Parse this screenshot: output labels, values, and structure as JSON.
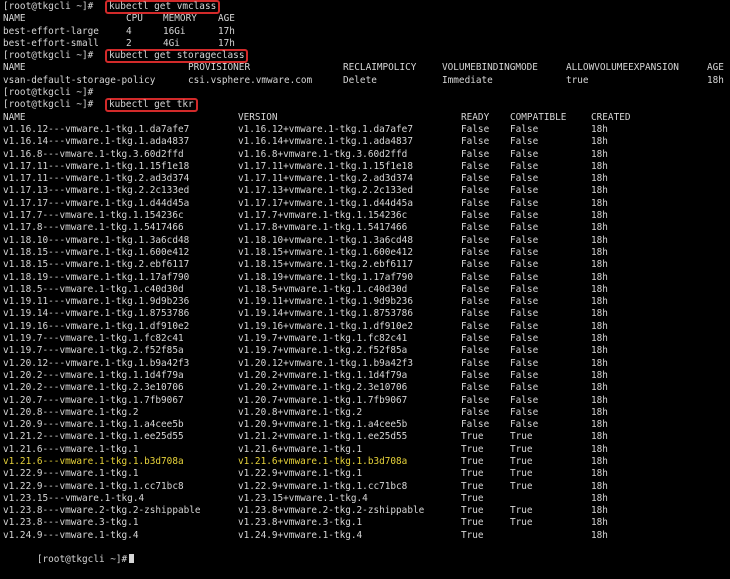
{
  "prompt": "[root@tkgcli ~]#",
  "blocks": [
    {
      "command": "kubectl get vmclass",
      "headers": [
        "NAME",
        "CPU",
        "MEMORY",
        "AGE"
      ],
      "rows": [
        [
          "best-effort-large",
          "4",
          "16Gi",
          "17h"
        ],
        [
          "best-effort-small",
          "2",
          "4Gi",
          "17h"
        ]
      ]
    },
    {
      "command": "kubectl get storageclass",
      "headers": [
        "NAME",
        "PROVISIONER",
        "RECLAIMPOLICY",
        "VOLUMEBINDINGMODE",
        "ALLOWVOLUMEEXPANSION",
        "AGE"
      ],
      "rows": [
        [
          "vsan-default-storage-policy",
          "csi.vsphere.vmware.com",
          "Delete",
          "Immediate",
          "true",
          "18h"
        ]
      ]
    },
    {
      "command": "kubectl get tkr",
      "headers": [
        "NAME",
        "VERSION",
        "READY",
        "COMPATIBLE",
        "CREATED"
      ],
      "rows": [
        [
          "v1.16.12---vmware.1-tkg.1.da7afe7",
          "v1.16.12+vmware.1-tkg.1.da7afe7",
          "False",
          "False",
          "18h"
        ],
        [
          "v1.16.14---vmware.1-tkg.1.ada4837",
          "v1.16.14+vmware.1-tkg.1.ada4837",
          "False",
          "False",
          "18h"
        ],
        [
          "v1.16.8---vmware.1-tkg.3.60d2ffd",
          "v1.16.8+vmware.1-tkg.3.60d2ffd",
          "False",
          "False",
          "18h"
        ],
        [
          "v1.17.11---vmware.1-tkg.1.15f1e18",
          "v1.17.11+vmware.1-tkg.1.15f1e18",
          "False",
          "False",
          "18h"
        ],
        [
          "v1.17.11---vmware.1-tkg.2.ad3d374",
          "v1.17.11+vmware.1-tkg.2.ad3d374",
          "False",
          "False",
          "18h"
        ],
        [
          "v1.17.13---vmware.1-tkg.2.2c133ed",
          "v1.17.13+vmware.1-tkg.2.2c133ed",
          "False",
          "False",
          "18h"
        ],
        [
          "v1.17.17---vmware.1-tkg.1.d44d45a",
          "v1.17.17+vmware.1-tkg.1.d44d45a",
          "False",
          "False",
          "18h"
        ],
        [
          "v1.17.7---vmware.1-tkg.1.154236c",
          "v1.17.7+vmware.1-tkg.1.154236c",
          "False",
          "False",
          "18h"
        ],
        [
          "v1.17.8---vmware.1-tkg.1.5417466",
          "v1.17.8+vmware.1-tkg.1.5417466",
          "False",
          "False",
          "18h"
        ],
        [
          "v1.18.10---vmware.1-tkg.1.3a6cd48",
          "v1.18.10+vmware.1-tkg.1.3a6cd48",
          "False",
          "False",
          "18h"
        ],
        [
          "v1.18.15---vmware.1-tkg.1.600e412",
          "v1.18.15+vmware.1-tkg.1.600e412",
          "False",
          "False",
          "18h"
        ],
        [
          "v1.18.15---vmware.1-tkg.2.ebf6117",
          "v1.18.15+vmware.1-tkg.2.ebf6117",
          "False",
          "False",
          "18h"
        ],
        [
          "v1.18.19---vmware.1-tkg.1.17af790",
          "v1.18.19+vmware.1-tkg.1.17af790",
          "False",
          "False",
          "18h"
        ],
        [
          "v1.18.5---vmware.1-tkg.1.c40d30d",
          "v1.18.5+vmware.1-tkg.1.c40d30d",
          "False",
          "False",
          "18h"
        ],
        [
          "v1.19.11---vmware.1-tkg.1.9d9b236",
          "v1.19.11+vmware.1-tkg.1.9d9b236",
          "False",
          "False",
          "18h"
        ],
        [
          "v1.19.14---vmware.1-tkg.1.8753786",
          "v1.19.14+vmware.1-tkg.1.8753786",
          "False",
          "False",
          "18h"
        ],
        [
          "v1.19.16---vmware.1-tkg.1.df910e2",
          "v1.19.16+vmware.1-tkg.1.df910e2",
          "False",
          "False",
          "18h"
        ],
        [
          "v1.19.7---vmware.1-tkg.1.fc82c41",
          "v1.19.7+vmware.1-tkg.1.fc82c41",
          "False",
          "False",
          "18h"
        ],
        [
          "v1.19.7---vmware.1-tkg.2.f52f85a",
          "v1.19.7+vmware.1-tkg.2.f52f85a",
          "False",
          "False",
          "18h"
        ],
        [
          "v1.20.12---vmware.1-tkg.1.b9a42f3",
          "v1.20.12+vmware.1-tkg.1.b9a42f3",
          "False",
          "False",
          "18h"
        ],
        [
          "v1.20.2---vmware.1-tkg.1.1d4f79a",
          "v1.20.2+vmware.1-tkg.1.1d4f79a",
          "False",
          "False",
          "18h"
        ],
        [
          "v1.20.2---vmware.1-tkg.2.3e10706",
          "v1.20.2+vmware.1-tkg.2.3e10706",
          "False",
          "False",
          "18h"
        ],
        [
          "v1.20.7---vmware.1-tkg.1.7fb9067",
          "v1.20.7+vmware.1-tkg.1.7fb9067",
          "False",
          "False",
          "18h"
        ],
        [
          "v1.20.8---vmware.1-tkg.2",
          "v1.20.8+vmware.1-tkg.2",
          "False",
          "False",
          "18h"
        ],
        [
          "v1.20.9---vmware.1-tkg.1.a4cee5b",
          "v1.20.9+vmware.1-tkg.1.a4cee5b",
          "False",
          "False",
          "18h"
        ],
        [
          "v1.21.2---vmware.1-tkg.1.ee25d55",
          "v1.21.2+vmware.1-tkg.1.ee25d55",
          "True",
          "True",
          "18h"
        ],
        [
          "v1.21.6---vmware.1-tkg.1",
          "v1.21.6+vmware.1-tkg.1",
          "True",
          "True",
          "18h"
        ],
        [
          "v1.21.6---vmware.1-tkg.1.b3d708a",
          "v1.21.6+vmware.1-tkg.1.b3d708a",
          "True",
          "True",
          "18h"
        ],
        [
          "v1.22.9---vmware.1-tkg.1",
          "v1.22.9+vmware.1-tkg.1",
          "True",
          "True",
          "18h"
        ],
        [
          "v1.22.9---vmware.1-tkg.1.cc71bc8",
          "v1.22.9+vmware.1-tkg.1.cc71bc8",
          "True",
          "True",
          "18h"
        ],
        [
          "v1.23.15---vmware.1-tkg.4",
          "v1.23.15+vmware.1-tkg.4",
          "True",
          "",
          "18h"
        ],
        [
          "v1.23.8---vmware.2-tkg.2-zshippable",
          "v1.23.8+vmware.2-tkg.2-zshippable",
          "True",
          "True",
          "18h"
        ],
        [
          "v1.23.8---vmware.3-tkg.1",
          "v1.23.8+vmware.3-tkg.1",
          "True",
          "True",
          "18h"
        ],
        [
          "v1.24.9---vmware.1-tkg.4",
          "v1.24.9+vmware.1-tkg.4",
          "True",
          "",
          "18h"
        ]
      ]
    }
  ],
  "highlight_colors": {
    "selected_row": "#e6d23a",
    "command_box": "#d22a2a",
    "text": "#d6d6d6",
    "background": "#000000"
  }
}
